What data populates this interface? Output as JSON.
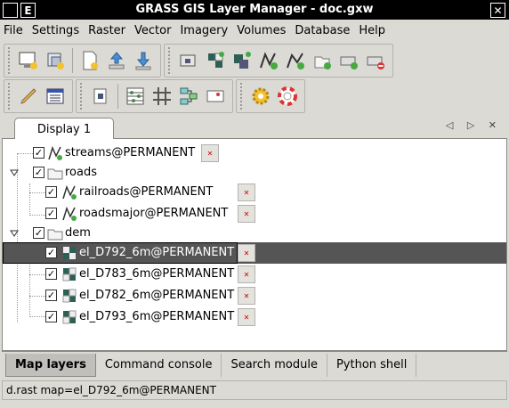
{
  "window": {
    "title": "GRASS GIS Layer Manager - doc.gxw",
    "menu_button": "E"
  },
  "menubar": {
    "items": [
      "File",
      "Settings",
      "Raster",
      "Vector",
      "Imagery",
      "Volumes",
      "Database",
      "Help"
    ]
  },
  "toolbar1": {
    "icons": [
      "new-display-icon",
      "new-workspace-icon",
      "open-workspace-icon",
      "import-raster-icon",
      "import-vector-icon",
      "add-raster-icon",
      "add-multiple-rasters-icon",
      "add-vector-icon",
      "add-multiple-vectors-icon",
      "add-overlay-icon",
      "add-group-icon",
      "remove-layer-icon",
      "delete-icon"
    ]
  },
  "toolbar2": {
    "icons": [
      "digitize-icon",
      "attribute-table-icon",
      "cartographic-composer-icon",
      "histogram-icon",
      "grid-icon",
      "modeler-icon",
      "georectify-icon",
      "settings-icon",
      "help-icon"
    ]
  },
  "notebook": {
    "tab_label": "Display 1",
    "nav": "◁ ▷ ✕"
  },
  "layers": [
    {
      "label": "streams@PERMANENT",
      "type": "vector",
      "checked": true,
      "depth": 1
    },
    {
      "label": "roads",
      "type": "group",
      "checked": true,
      "depth": 0,
      "expanded": true
    },
    {
      "label": "railroads@PERMANENT",
      "type": "vector",
      "checked": true,
      "depth": 2
    },
    {
      "label": "roadsmajor@PERMANENT",
      "type": "vector",
      "checked": true,
      "depth": 2
    },
    {
      "label": "dem",
      "type": "group",
      "checked": true,
      "depth": 0,
      "expanded": true
    },
    {
      "label": "el_D792_6m@PERMANENT",
      "type": "raster",
      "checked": true,
      "depth": 2,
      "selected": true
    },
    {
      "label": "el_D783_6m@PERMANENT",
      "type": "raster",
      "checked": true,
      "depth": 2
    },
    {
      "label": "el_D782_6m@PERMANENT",
      "type": "raster",
      "checked": true,
      "depth": 2
    },
    {
      "label": "el_D793_6m@PERMANENT",
      "type": "raster",
      "checked": true,
      "depth": 2
    }
  ],
  "bottom_tabs": [
    "Map layers",
    "Command console",
    "Search module",
    "Python shell"
  ],
  "status": "d.rast map=el_D792_6m@PERMANENT",
  "colors": {
    "selected_row": "#555555",
    "background": "#dcdad5",
    "title_bar": "#000000"
  }
}
